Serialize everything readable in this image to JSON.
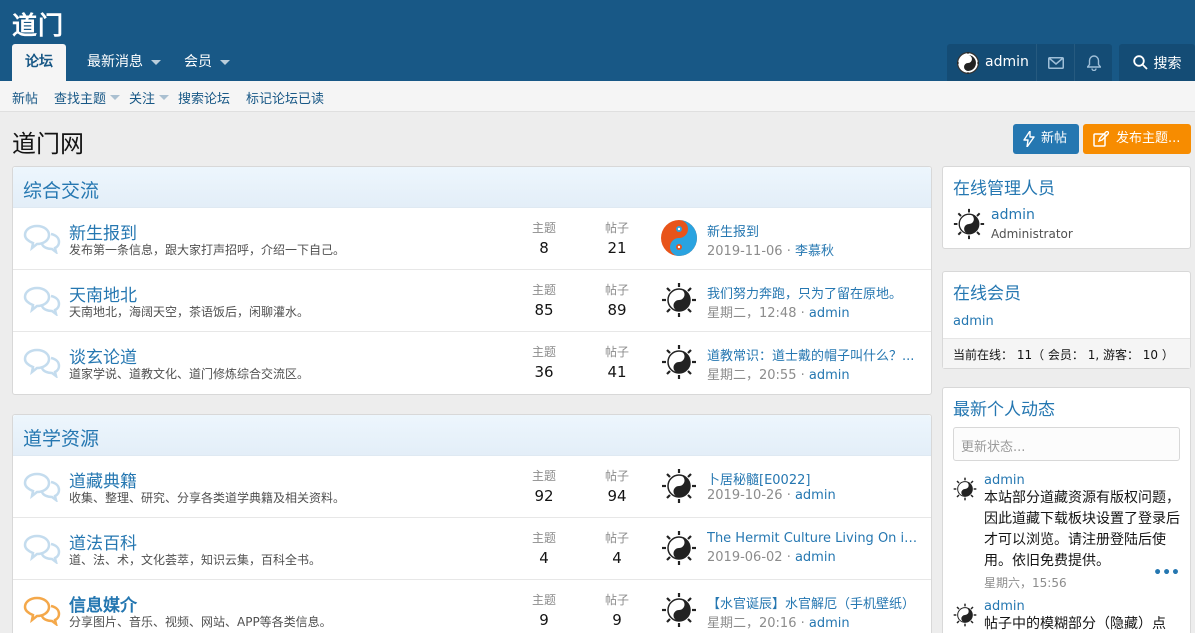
{
  "header": {
    "logo": "道门",
    "tabs": [
      {
        "label": "论坛"
      },
      {
        "label": "最新消息"
      },
      {
        "label": "会员"
      }
    ],
    "user": "admin",
    "search": "搜索"
  },
  "subnav": [
    "新帖",
    "查找主题",
    "关注",
    "搜索论坛",
    "标记论坛已读"
  ],
  "page": {
    "title": "道门网",
    "new_posts_btn": "新帖",
    "post_thread_btn": "发布主题..."
  },
  "labels": {
    "threads": "主题",
    "posts": "帖子"
  },
  "categories": [
    {
      "title": "综合交流",
      "forums": [
        {
          "title": "新生报到",
          "desc": "发布第一条信息，跟大家打声招呼，介绍一下自己。",
          "threads": "8",
          "posts": "21",
          "last_title": "新生报到",
          "last_date": "2019-11-06",
          "last_user": "李慕秋"
        },
        {
          "title": "天南地北",
          "desc": "天南地北，海阔天空，茶语饭后，闲聊灌水。",
          "threads": "85",
          "posts": "89",
          "last_title": "我们努力奔跑，只为了留在原地。",
          "last_date": "星期二，12:48",
          "last_user": "admin"
        },
        {
          "title": "谈玄论道",
          "desc": "道家学说、道教文化、道门修炼综合交流区。",
          "threads": "36",
          "posts": "41",
          "last_title": "道教常识：道士戴的帽子叫什么？...",
          "last_date": "星期二，20:55",
          "last_user": "admin"
        }
      ]
    },
    {
      "title": "道学资源",
      "forums": [
        {
          "title": "道藏典籍",
          "desc": "收集、整理、研究、分享各类道学典籍及相关资料。",
          "threads": "92",
          "posts": "94",
          "last_title": "卜居秘髓[E0022]",
          "last_date": "2019-10-26",
          "last_user": "admin"
        },
        {
          "title": "道法百科",
          "desc": "道、法、术，文化荟萃，知识云集，百科全书。",
          "threads": "4",
          "posts": "4",
          "last_title": "The Hermit Culture Living On in Chi...",
          "last_date": "2019-06-02",
          "last_user": "admin"
        },
        {
          "title": "信息媒介",
          "desc": "分享图片、音乐、视频、网站、APP等各类信息。",
          "threads": "9",
          "posts": "9",
          "last_title": "【水官诞辰】水官解厄（手机壁纸）",
          "last_date": "星期二，20:16",
          "last_user": "admin"
        }
      ]
    }
  ],
  "sidebar": {
    "staff_title": "在线管理人员",
    "staff_name": "admin",
    "staff_role": "Administrator",
    "members_title": "在线会员",
    "members_name": "admin",
    "online_stats": "当前在线： 11（ 会员： 1, 游客： 10 ）",
    "activity_title": "最新个人动态",
    "status_placeholder": "更新状态...",
    "activities": [
      {
        "name": "admin",
        "text": "本站部分道藏资源有版权问题，因此道藏下载板块设置了登录后才可以浏览。请注册登陆后使用。依旧免费提供。",
        "time": "星期六，15:56"
      },
      {
        "name": "admin",
        "text": "帖子中的模糊部分（隐藏）点"
      }
    ]
  },
  "colors": {
    "header": "#185886",
    "accent": "#2577b1",
    "orange": "#f78c00"
  }
}
